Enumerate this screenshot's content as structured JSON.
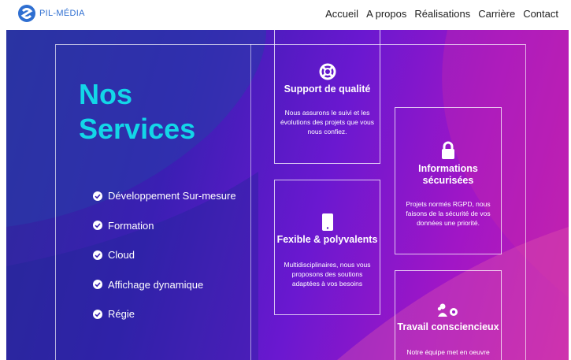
{
  "header": {
    "logo_text": "PIL-MÉDIA",
    "nav": [
      "Accueil",
      "A propos",
      "Réalisations",
      "Carrière",
      "Contact"
    ]
  },
  "hero": {
    "title_line1": "Nos",
    "title_line2": "Services",
    "services": [
      "Développement Sur-mesure",
      "Formation",
      "Cloud",
      "Affichage dynamique",
      "Régie"
    ]
  },
  "cards": [
    {
      "icon": "lifebuoy-icon",
      "title": "Support de qualité",
      "text": [
        "Nous assurons le suivi et les",
        "évolutions des projets que vous",
        "nous confiez."
      ]
    },
    {
      "icon": "lock-icon",
      "title_lines": [
        "Informations",
        "sécurisées"
      ],
      "text": [
        "Projets normés RGPD, nous",
        "faisons de la sécurité de vos",
        "données une priorité."
      ]
    },
    {
      "icon": "mobile-icon",
      "title": "Fexible & polyvalents",
      "text": [
        "Multidisciplinaires, nous vous",
        "proposons des soutions",
        "adaptées à vos besoins"
      ]
    },
    {
      "icon": "team-gear-icon",
      "title": "Travail consciencieux",
      "text": [
        "Notre équipe met en oeuvre"
      ]
    }
  ],
  "colors": {
    "title": "#13d6e8",
    "accent_blue": "#2f6fd1"
  }
}
